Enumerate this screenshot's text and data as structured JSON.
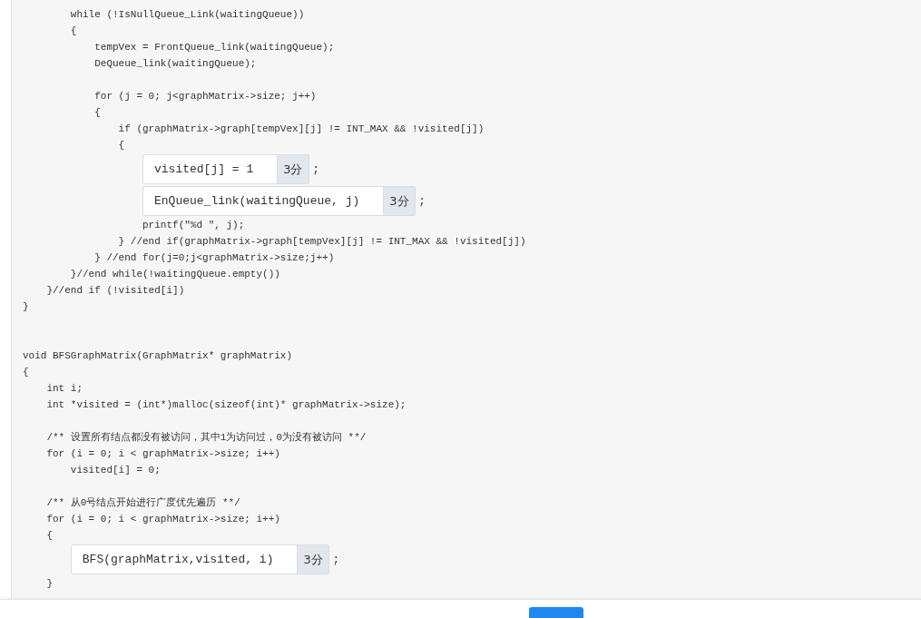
{
  "code_lines": [
    {
      "kind": "code",
      "text": "        while (!IsNullQueue_Link(waitingQueue))"
    },
    {
      "kind": "code",
      "text": "        {"
    },
    {
      "kind": "code",
      "text": "            tempVex = FrontQueue_link(waitingQueue);"
    },
    {
      "kind": "code",
      "text": "            DeQueue_link(waitingQueue);"
    },
    {
      "kind": "blank"
    },
    {
      "kind": "code",
      "text": "            for (j = 0; j<graphMatrix->size; j++)"
    },
    {
      "kind": "code",
      "text": "            {"
    },
    {
      "kind": "code",
      "text": "                if (graphMatrix->graph[tempVex][j] != INT_MAX && !visited[j])"
    },
    {
      "kind": "code",
      "text": "                {"
    },
    {
      "kind": "answer",
      "value": "visited[j] = 1",
      "score": "3分",
      "suffix": ";"
    },
    {
      "kind": "answer",
      "value": "EnQueue_link(waitingQueue, j)",
      "score": "3分",
      "suffix": ";"
    },
    {
      "kind": "code",
      "text": "                    printf(\"%d \", j);"
    },
    {
      "kind": "code",
      "text": "                } //end if(graphMatrix->graph[tempVex][j] != INT_MAX && !visited[j])"
    },
    {
      "kind": "code",
      "text": "            } //end for(j=0;j<graphMatrix->size;j++)"
    },
    {
      "kind": "code",
      "text": "        }//end while(!waitingQueue.empty())"
    },
    {
      "kind": "code",
      "text": "    }//end if (!visited[i])"
    },
    {
      "kind": "code",
      "text": "}"
    },
    {
      "kind": "blank"
    },
    {
      "kind": "blank"
    },
    {
      "kind": "code",
      "text": "void BFSGraphMatrix(GraphMatrix* graphMatrix)"
    },
    {
      "kind": "code",
      "text": "{"
    },
    {
      "kind": "code",
      "text": "    int i;"
    },
    {
      "kind": "code",
      "text": "    int *visited = (int*)malloc(sizeof(int)* graphMatrix->size);"
    },
    {
      "kind": "blank"
    },
    {
      "kind": "code",
      "text": "    /** 设置所有结点都没有被访问，其中1为访问过，0为没有被访问 **/"
    },
    {
      "kind": "code",
      "text": "    for (i = 0; i < graphMatrix->size; i++)"
    },
    {
      "kind": "code",
      "text": "        visited[i] = 0;"
    },
    {
      "kind": "blank"
    },
    {
      "kind": "code",
      "text": "    /** 从0号结点开始进行广度优先遍历 **/"
    },
    {
      "kind": "code",
      "text": "    for (i = 0; i < graphMatrix->size; i++)"
    },
    {
      "kind": "code",
      "text": "    {"
    },
    {
      "kind": "answer",
      "value": "BFS(graphMatrix,visited, i)",
      "score": "3分",
      "suffix": ";"
    },
    {
      "kind": "code",
      "text": "    }"
    }
  ]
}
